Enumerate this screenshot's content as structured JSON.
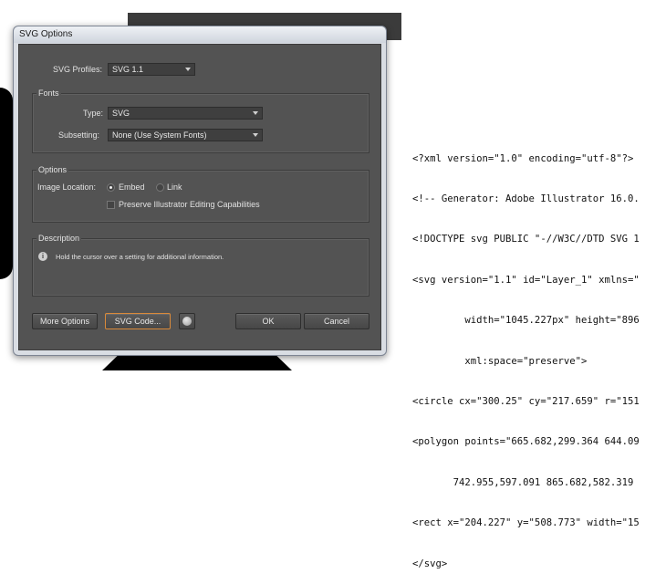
{
  "dialog": {
    "title": "SVG Options",
    "svg_profiles_label": "SVG Profiles:",
    "svg_profiles_value": "SVG 1.1",
    "fonts": {
      "title": "Fonts",
      "type_label": "Type:",
      "type_value": "SVG",
      "subsetting_label": "Subsetting:",
      "subsetting_value": "None (Use System Fonts)"
    },
    "options": {
      "title": "Options",
      "image_location_label": "Image Location:",
      "embed_label": "Embed",
      "link_label": "Link",
      "preserve_label": "Preserve Illustrator Editing Capabilities"
    },
    "description": {
      "title": "Description",
      "text": "Hold the cursor over a setting for additional information."
    },
    "buttons": {
      "more_options": "More Options",
      "svg_code": "SVG Code...",
      "ok": "OK",
      "cancel": "Cancel"
    }
  },
  "code_lines": [
    "<?xml version=\"1.0\" encoding=\"utf-8\"?>",
    "<!-- Generator: Adobe Illustrator 16.0.",
    "<!DOCTYPE svg PUBLIC \"-//W3C//DTD SVG 1",
    "<svg version=\"1.1\" id=\"Layer_1\" xmlns=\"",
    "         width=\"1045.227px\" height=\"896",
    "         xml:space=\"preserve\">",
    "<circle cx=\"300.25\" cy=\"217.659\" r=\"151",
    "<polygon points=\"665.682,299.364 644.09",
    "       742.955,597.091 865.682,582.319",
    "<rect x=\"204.227\" y=\"508.773\" width=\"15",
    "</svg>"
  ]
}
